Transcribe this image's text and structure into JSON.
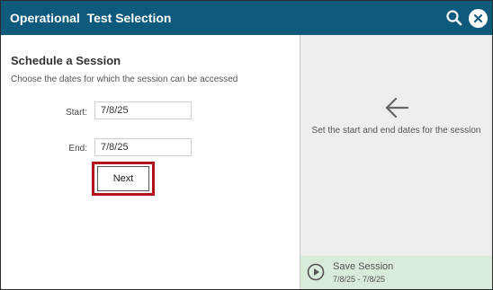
{
  "header": {
    "title": "Operational  Test Selection",
    "search_icon": "search-icon",
    "close_icon": "close-icon"
  },
  "schedule": {
    "heading": "Schedule a Session",
    "description": "Choose the dates for which the session can be accessed",
    "start_label": "Start:",
    "start_value": "7/8/25",
    "end_label": "End:",
    "end_value": "7/8/25",
    "next_label": "Next"
  },
  "side_panel": {
    "arrow_icon": "arrow-left-icon",
    "hint": "Set the start and end dates for the session"
  },
  "save_session": {
    "icon": "play-icon",
    "label": "Save Session",
    "dates": "7/8/25 - 7/8/25"
  },
  "colors": {
    "header_bg": "#0e5a7d",
    "highlight": "#b3141b",
    "save_bar_bg": "#d9ebd9",
    "right_pane_bg": "#eeeeee"
  }
}
